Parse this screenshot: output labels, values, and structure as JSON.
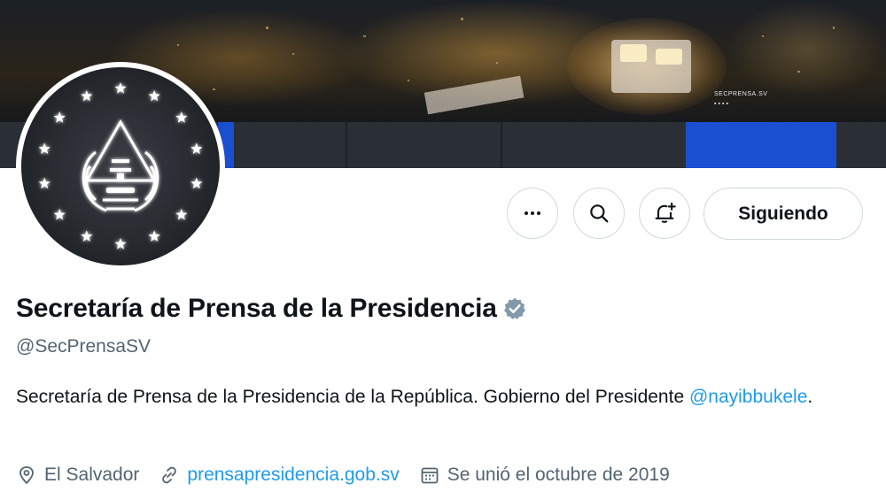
{
  "banner": {
    "logo_text": "SECPRENSA.SV",
    "logo_icons": "▪▪▪▪",
    "accent_color": "#1a4fd1"
  },
  "profile": {
    "display_name": "Secretaría de Prensa de la Presidencia",
    "handle": "@SecPrensaSV",
    "bio_text": "Secretaría de Prensa de la Presidencia de la República. Gobierno del Presidente ",
    "bio_mention": "@nayibbukele",
    "bio_suffix": ".",
    "location": "El Salvador",
    "website": "prensapresidencia.gob.sv",
    "joined": "Se unió el octubre de 2019",
    "verified_color": "#829aab"
  },
  "actions": {
    "more_icon": "more-icon",
    "search_icon": "search-icon",
    "notify_icon": "bell-plus-icon",
    "follow_label": "Siguiendo"
  },
  "colors": {
    "link": "#1d9bf0",
    "secondary_text": "#536471",
    "border": "#cfd9de"
  }
}
